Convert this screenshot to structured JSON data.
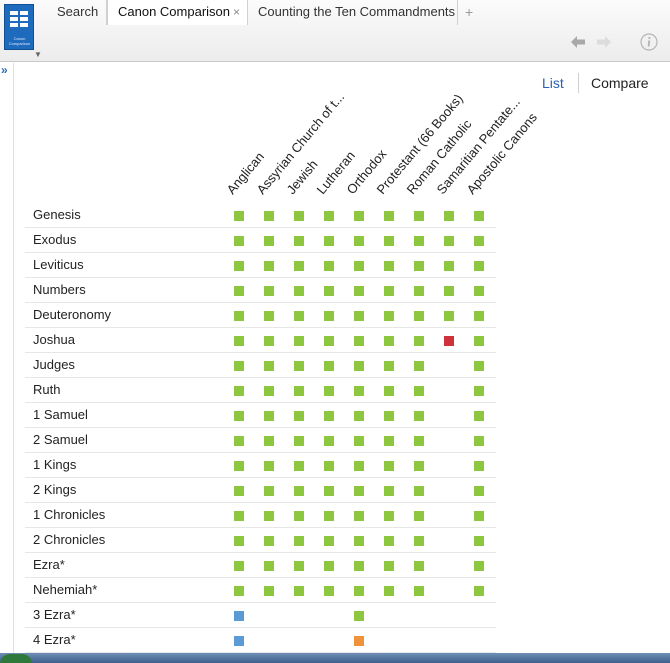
{
  "app": {
    "icon_caption": "Canon Comparison"
  },
  "tabs": [
    {
      "label": "Search",
      "active": false
    },
    {
      "label": "Canon Comparison",
      "active": true,
      "close": "×"
    },
    {
      "label": "Counting the Ten Commandments",
      "active": false
    }
  ],
  "add_tab": "+",
  "view": {
    "list_label": "List",
    "compare_label": "Compare"
  },
  "colors": {
    "included": "#8dc63f",
    "partial": "#d0323c",
    "appendix": "#5b9bd5",
    "other": "#f0923a",
    "link": "#2a62b0"
  },
  "columns": [
    "Anglican",
    "Assyrian Church of t...",
    "Jewish",
    "Lutheran",
    "Orthodox",
    "Protestant (66 Books)",
    "Roman Catholic",
    "Samaritian Pentate...",
    "Apostolic Canons"
  ],
  "rows": [
    {
      "book": "Genesis",
      "cells": [
        "included",
        "included",
        "included",
        "included",
        "included",
        "included",
        "included",
        "included",
        "included"
      ]
    },
    {
      "book": "Exodus",
      "cells": [
        "included",
        "included",
        "included",
        "included",
        "included",
        "included",
        "included",
        "included",
        "included"
      ]
    },
    {
      "book": "Leviticus",
      "cells": [
        "included",
        "included",
        "included",
        "included",
        "included",
        "included",
        "included",
        "included",
        "included"
      ]
    },
    {
      "book": "Numbers",
      "cells": [
        "included",
        "included",
        "included",
        "included",
        "included",
        "included",
        "included",
        "included",
        "included"
      ]
    },
    {
      "book": "Deuteronomy",
      "cells": [
        "included",
        "included",
        "included",
        "included",
        "included",
        "included",
        "included",
        "included",
        "included"
      ]
    },
    {
      "book": "Joshua",
      "cells": [
        "included",
        "included",
        "included",
        "included",
        "included",
        "included",
        "included",
        "partial",
        "included"
      ]
    },
    {
      "book": "Judges",
      "cells": [
        "included",
        "included",
        "included",
        "included",
        "included",
        "included",
        "included",
        null,
        "included"
      ]
    },
    {
      "book": "Ruth",
      "cells": [
        "included",
        "included",
        "included",
        "included",
        "included",
        "included",
        "included",
        null,
        "included"
      ]
    },
    {
      "book": "1 Samuel",
      "cells": [
        "included",
        "included",
        "included",
        "included",
        "included",
        "included",
        "included",
        null,
        "included"
      ]
    },
    {
      "book": "2 Samuel",
      "cells": [
        "included",
        "included",
        "included",
        "included",
        "included",
        "included",
        "included",
        null,
        "included"
      ]
    },
    {
      "book": "1 Kings",
      "cells": [
        "included",
        "included",
        "included",
        "included",
        "included",
        "included",
        "included",
        null,
        "included"
      ]
    },
    {
      "book": "2 Kings",
      "cells": [
        "included",
        "included",
        "included",
        "included",
        "included",
        "included",
        "included",
        null,
        "included"
      ]
    },
    {
      "book": "1 Chronicles",
      "cells": [
        "included",
        "included",
        "included",
        "included",
        "included",
        "included",
        "included",
        null,
        "included"
      ]
    },
    {
      "book": "2 Chronicles",
      "cells": [
        "included",
        "included",
        "included",
        "included",
        "included",
        "included",
        "included",
        null,
        "included"
      ]
    },
    {
      "book": "Ezra*",
      "cells": [
        "included",
        "included",
        "included",
        "included",
        "included",
        "included",
        "included",
        null,
        "included"
      ]
    },
    {
      "book": "Nehemiah*",
      "cells": [
        "included",
        "included",
        "included",
        "included",
        "included",
        "included",
        "included",
        null,
        "included"
      ]
    },
    {
      "book": "3 Ezra*",
      "cells": [
        "appendix",
        null,
        null,
        null,
        "included",
        null,
        null,
        null,
        null
      ]
    },
    {
      "book": "4 Ezra*",
      "cells": [
        "appendix",
        null,
        null,
        null,
        "other",
        null,
        null,
        null,
        null
      ]
    }
  ]
}
